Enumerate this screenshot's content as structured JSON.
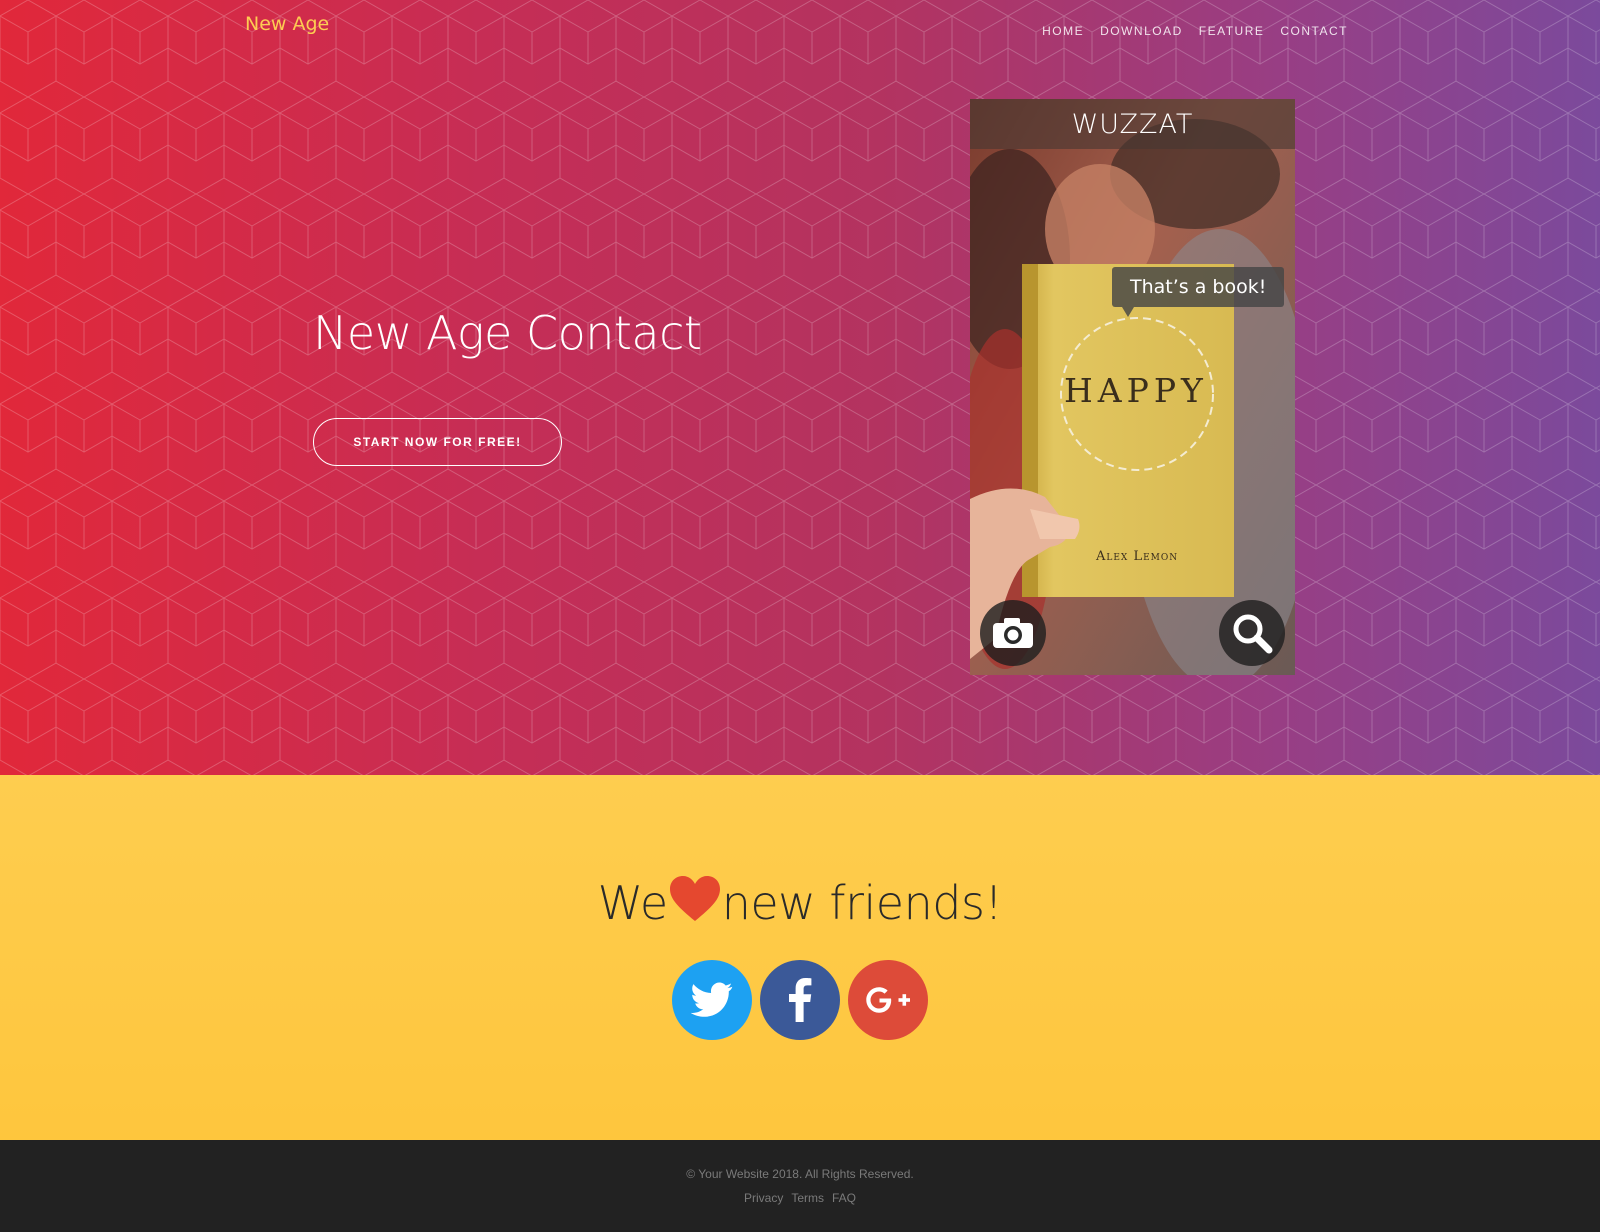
{
  "navbar": {
    "brand": "New Age",
    "links": [
      {
        "label": "HOME"
      },
      {
        "label": "DOWNLOAD"
      },
      {
        "label": "FEATURE"
      },
      {
        "label": "CONTACT"
      }
    ]
  },
  "hero": {
    "title": "New Age Contact",
    "cta_label": "START NOW FOR FREE!"
  },
  "device": {
    "app_title": "WUZZAT",
    "bubble_text": "That’s a book!",
    "book_title": "HAPPY",
    "book_author": "Alex Lemon",
    "camera_icon": "camera-icon",
    "search_icon": "magnifier-icon"
  },
  "friends": {
    "heading_before": "We",
    "heading_after": "new friends!",
    "heart_icon": "heart-icon",
    "socials": [
      {
        "icon": "twitter-icon",
        "color": "#1da1f2"
      },
      {
        "icon": "facebook-icon",
        "color": "#3b5998"
      },
      {
        "icon": "google-plus-icon",
        "color": "#dd4b39"
      }
    ]
  },
  "footer": {
    "copyright": "© Your Website 2018. All Rights Reserved.",
    "links": [
      {
        "label": "Privacy"
      },
      {
        "label": "Terms"
      },
      {
        "label": "FAQ"
      }
    ]
  },
  "colors": {
    "brand": "#fdcc52",
    "hero_gradient_start": "#e1283a",
    "hero_gradient_end": "#7b4a9c",
    "friends_bg": "#fecd4f",
    "footer_bg": "#222222"
  }
}
